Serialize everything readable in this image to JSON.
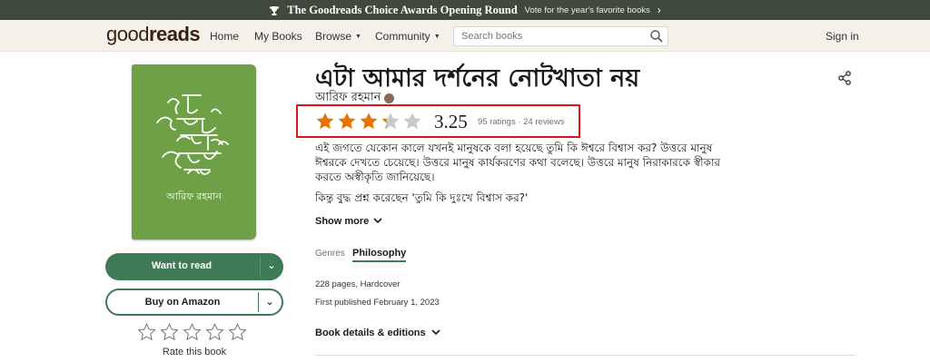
{
  "banner": {
    "icon": "trophy-icon",
    "main_text": "The Goodreads Choice Awards Opening Round",
    "sub_text": "Vote for the year's favorite books"
  },
  "nav": {
    "logo_light": "good",
    "logo_bold": "reads",
    "home": "Home",
    "my_books": "My Books",
    "browse": "Browse",
    "community": "Community",
    "search_placeholder": "Search books",
    "sign_in": "Sign in"
  },
  "book": {
    "cover_color": "#6ea046",
    "cover_author": "আরিফ রহমান",
    "title": "এটা আমার দর্শনের নোটখাতা নয়",
    "author": "আরিফ রহমান",
    "avg_rating": "3.25",
    "rating_value": 3.25,
    "counts": "95 ratings · 24 reviews",
    "description": "এই জগতে যেকোন কালে যখনই মানুষকে বলা হয়েছে তুমি কি ঈশ্বরে বিশ্বাস কর? উত্তরে মানুষ ঈশ্বরকে দেখতে চেয়েছে। উত্তরে মানুষ কার্যকরণের কথা বলেছে। উত্তরে মানুষ নিরাকারকে স্বীকার করতে অস্বীকৃতি জানিয়েছে।",
    "description_2": "কিন্তু বুদ্ধ প্রশ্ন করেছেন 'তুমি কি দুঃখে বিশ্বাস কর?'",
    "show_more": "Show more",
    "genres_label": "Genres",
    "genre": "Philosophy",
    "format": "228 pages, Hardcover",
    "published": "First published February 1, 2023",
    "book_details": "Book details & editions"
  },
  "actions": {
    "want_to_read": "Want to read",
    "buy_amazon": "Buy on Amazon",
    "rate_label": "Rate this book"
  },
  "colors": {
    "star_fill": "#e87400",
    "star_empty": "#c9c9c9",
    "accent_green": "#3f7a57",
    "highlight_box": "#e0121b"
  }
}
